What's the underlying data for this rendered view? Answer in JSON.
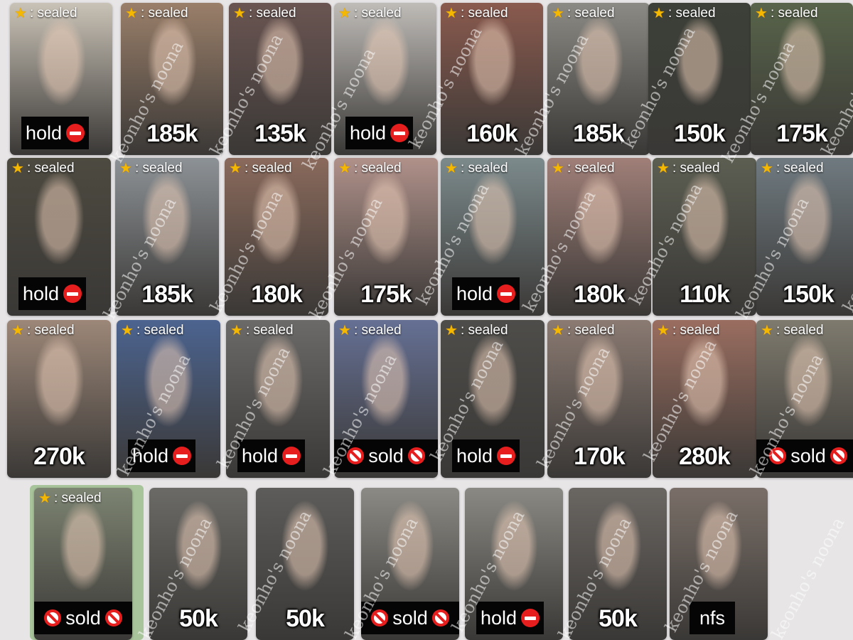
{
  "sealed_star_icon": "star-emoji",
  "sealed_label": ": sealed",
  "watermark_text": "keonho's noona",
  "status_icons": {
    "hold": "no-entry-icon",
    "sold": "prohibited-icon"
  },
  "palette": {
    "tag_bg": "#050505",
    "no_entry": "#e61e1e",
    "star": "#f5b800",
    "frame_green": "#a8c49b"
  },
  "cards": [
    {
      "sealed": true,
      "status": "hold",
      "label": "hold",
      "bg": "#c9c2b6"
    },
    {
      "sealed": true,
      "status": "price",
      "label": "185k",
      "bg": "#9a7f6a"
    },
    {
      "sealed": true,
      "status": "price",
      "label": "135k",
      "bg": "#6a5552"
    },
    {
      "sealed": true,
      "status": "hold",
      "label": "hold",
      "bg": "#bfbcb8"
    },
    {
      "sealed": true,
      "status": "price",
      "label": "160k",
      "bg": "#8a5a4e"
    },
    {
      "sealed": true,
      "status": "price",
      "label": "185k",
      "bg": "#8c8a84"
    },
    {
      "sealed": true,
      "status": "price",
      "label": "150k",
      "bg": "#3c4038"
    },
    {
      "sealed": true,
      "status": "price",
      "label": "175k",
      "bg": "#58644a"
    },
    {
      "sealed": true,
      "status": "hold",
      "label": "hold",
      "bg": "#4d4a40"
    },
    {
      "sealed": true,
      "status": "price",
      "label": "185k",
      "bg": "#8d9296"
    },
    {
      "sealed": true,
      "status": "price",
      "label": "180k",
      "bg": "#8a6a5c"
    },
    {
      "sealed": true,
      "status": "price",
      "label": "175k",
      "bg": "#b0918a"
    },
    {
      "sealed": true,
      "status": "hold",
      "label": "hold",
      "bg": "#7c8a8c"
    },
    {
      "sealed": true,
      "status": "price",
      "label": "180k",
      "bg": "#a07f78"
    },
    {
      "sealed": true,
      "status": "price",
      "label": "110k",
      "bg": "#5c5e52"
    },
    {
      "sealed": true,
      "status": "price",
      "label": "150k",
      "bg": "#6f7a80"
    },
    {
      "sealed": true,
      "status": "price",
      "label": "270k",
      "bg": "#9c8778"
    },
    {
      "sealed": true,
      "status": "hold",
      "label": "hold",
      "bg": "#4c6490"
    },
    {
      "sealed": true,
      "status": "hold",
      "label": "hold",
      "bg": "#6c6a68"
    },
    {
      "sealed": true,
      "status": "sold",
      "label": "sold",
      "bg": "#657094"
    },
    {
      "sealed": true,
      "status": "hold",
      "label": "hold",
      "bg": "#4e4d4a"
    },
    {
      "sealed": true,
      "status": "price",
      "label": "170k",
      "bg": "#8a7a72"
    },
    {
      "sealed": true,
      "status": "price",
      "label": "280k",
      "bg": "#9a6e60"
    },
    {
      "sealed": true,
      "status": "sold",
      "label": "sold",
      "bg": "#7e7a6e"
    },
    {
      "sealed": true,
      "status": "sold",
      "label": "sold",
      "bg": "#7d8472"
    },
    {
      "sealed": false,
      "status": "price",
      "label": "50k",
      "bg": "#6b6a66"
    },
    {
      "sealed": false,
      "status": "price",
      "label": "50k",
      "bg": "#5d5c5a"
    },
    {
      "sealed": false,
      "status": "sold",
      "label": "sold",
      "bg": "#8c8a84"
    },
    {
      "sealed": false,
      "status": "hold",
      "label": "hold",
      "bg": "#8a8983"
    },
    {
      "sealed": false,
      "status": "price",
      "label": "50k",
      "bg": "#6a6662"
    },
    {
      "sealed": false,
      "status": "nfs",
      "label": "nfs",
      "bg": "#7a6f68"
    }
  ]
}
